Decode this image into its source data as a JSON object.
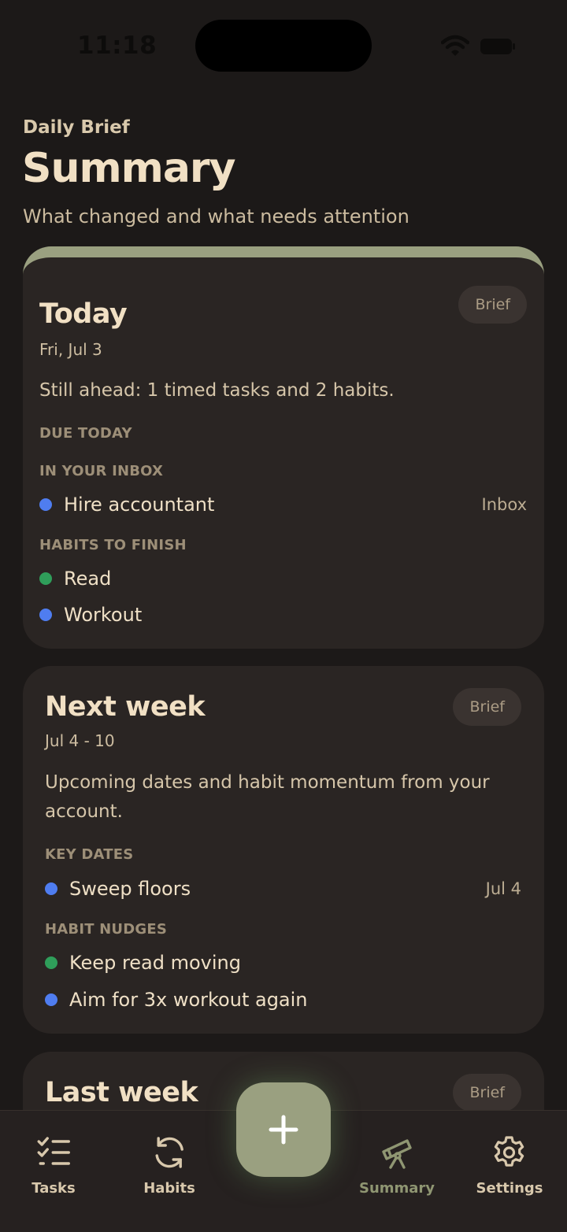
{
  "status_bar": {
    "time": "11:18"
  },
  "header": {
    "eyebrow": "Daily Brief",
    "title": "Summary",
    "subtitle": "What changed and what needs attention"
  },
  "colors": {
    "accent_sage": "#9aa080",
    "dot_blue": "#4f7df0",
    "dot_green": "#2f9e5a",
    "background": "#1c1918",
    "card": "#2a2523"
  },
  "cards": [
    {
      "title": "Today",
      "date": "Fri, Jul 3",
      "badge": "Brief",
      "summary": "Still ahead: 1 timed tasks and 2 habits.",
      "sections": [
        {
          "label": "DUE TODAY",
          "items": []
        },
        {
          "label": "IN YOUR INBOX",
          "items": [
            {
              "label": "Hire accountant",
              "meta": "Inbox",
              "color": "#4f7df0"
            }
          ]
        },
        {
          "label": "HABITS TO FINISH",
          "items": [
            {
              "label": "Read",
              "color": "#2f9e5a"
            },
            {
              "label": "Workout",
              "color": "#4f7df0"
            }
          ]
        }
      ]
    },
    {
      "title": "Next week",
      "date": "Jul 4 - 10",
      "badge": "Brief",
      "summary_lines": [
        "Upcoming dates and habit momentum from your",
        "account."
      ],
      "sections": [
        {
          "label": "KEY DATES",
          "items": [
            {
              "label": "Sweep floors",
              "meta": "Jul 4",
              "color": "#4f7df0"
            }
          ]
        },
        {
          "label": "HABIT NUDGES",
          "items": [
            {
              "label": "Keep read moving",
              "color": "#2f9e5a"
            },
            {
              "label": "Aim for 3x workout again",
              "color": "#4f7df0"
            }
          ]
        }
      ]
    },
    {
      "title": "Last week",
      "badge": "Brief"
    }
  ],
  "nav": {
    "items": [
      {
        "label": "Tasks",
        "icon": "tasks-checklist-icon",
        "active": true
      },
      {
        "label": "Habits",
        "icon": "refresh-icon",
        "active": true
      },
      {
        "label": "Summary",
        "icon": "telescope-icon",
        "active": false
      },
      {
        "label": "Settings",
        "icon": "gear-icon",
        "active": true
      }
    ],
    "fab_icon": "plus-icon"
  }
}
